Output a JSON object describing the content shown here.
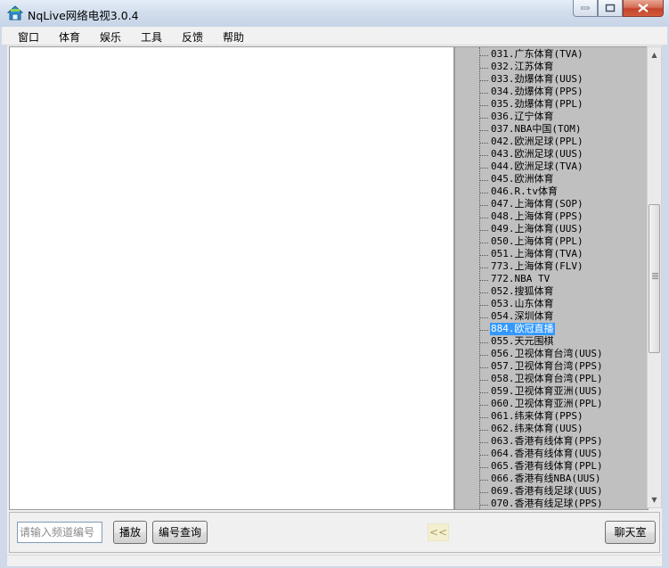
{
  "window": {
    "title": "NqLive网络电视3.0.4",
    "icon": "house-icon"
  },
  "menu": [
    {
      "label": "窗口"
    },
    {
      "label": "体育"
    },
    {
      "label": "娱乐"
    },
    {
      "label": "工具"
    },
    {
      "label": "反馈"
    },
    {
      "label": "帮助"
    }
  ],
  "channels": [
    {
      "label": "031.广东体育(TVA)"
    },
    {
      "label": "032.江苏体育"
    },
    {
      "label": "033.劲爆体育(UUS)"
    },
    {
      "label": "034.劲爆体育(PPS)"
    },
    {
      "label": "035.劲爆体育(PPL)"
    },
    {
      "label": "036.辽宁体育"
    },
    {
      "label": "037.NBA中国(TOM)"
    },
    {
      "label": "042.欧洲足球(PPL)"
    },
    {
      "label": "043.欧洲足球(UUS)"
    },
    {
      "label": "044.欧洲足球(TVA)"
    },
    {
      "label": "045.欧洲体育"
    },
    {
      "label": "046.R.tv体育"
    },
    {
      "label": "047.上海体育(SOP)"
    },
    {
      "label": "048.上海体育(PPS)"
    },
    {
      "label": "049.上海体育(UUS)"
    },
    {
      "label": "050.上海体育(PPL)"
    },
    {
      "label": "051.上海体育(TVA)"
    },
    {
      "label": "773.上海体育(FLV)"
    },
    {
      "label": "772.NBA TV"
    },
    {
      "label": "052.搜狐体育"
    },
    {
      "label": "053.山东体育"
    },
    {
      "label": "054.深圳体育"
    },
    {
      "label": "884.欧冠直播",
      "selected": true
    },
    {
      "label": "055.天元围棋"
    },
    {
      "label": "056.卫视体育台湾(UUS)"
    },
    {
      "label": "057.卫视体育台湾(PPS)"
    },
    {
      "label": "058.卫视体育台湾(PPL)"
    },
    {
      "label": "059.卫视体育亚洲(UUS)"
    },
    {
      "label": "060.卫视体育亚洲(PPL)"
    },
    {
      "label": "061.纬来体育(PPS)"
    },
    {
      "label": "062.纬来体育(UUS)"
    },
    {
      "label": "063.香港有线体育(PPS)"
    },
    {
      "label": "064.香港有线体育(UUS)"
    },
    {
      "label": "065.香港有线体育(PPL)"
    },
    {
      "label": "066.香港有线NBA(UUS)"
    },
    {
      "label": "069.香港有线足球(UUS)"
    },
    {
      "label": "070.香港有线足球(PPS)"
    }
  ],
  "bottom": {
    "input_placeholder": "请输入频道编号",
    "play_label": "播放",
    "lookup_label": "编号查询",
    "collapse_label": "<<",
    "chat_label": "聊天室"
  },
  "colors": {
    "selection": "#3399ff",
    "channel_panel_bg": "#c0c0c0"
  }
}
